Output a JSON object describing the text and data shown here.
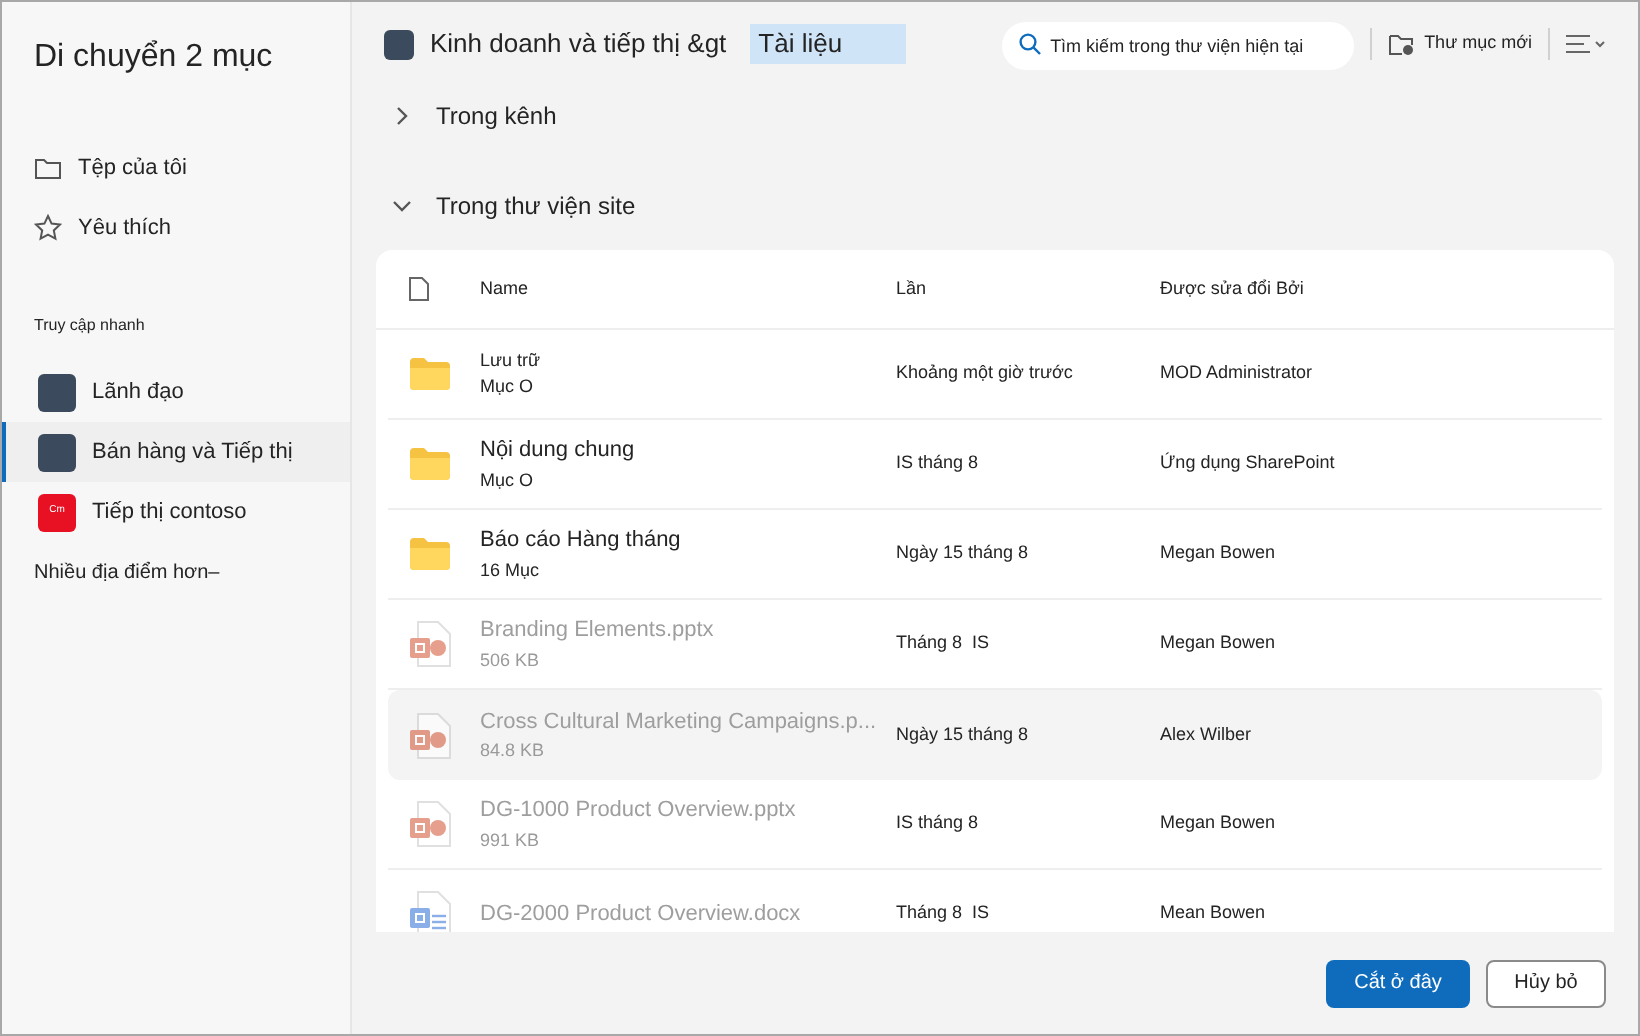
{
  "dialog": {
    "title": "Di chuyển 2 mục"
  },
  "sidebar": {
    "items": [
      {
        "kind": "folder",
        "label": "Tệp của tôi"
      },
      {
        "kind": "star",
        "label": "Yêu thích"
      }
    ],
    "quick_access": {
      "heading": "Truy cập nhanh",
      "items": [
        {
          "label": "Lãnh đạo",
          "color": "#3b4a5c",
          "selected": false
        },
        {
          "label": "Bán hàng và Tiếp thị",
          "color": "#3b4a5c",
          "selected": true
        },
        {
          "label": "Tiếp thị contoso",
          "color": "#e81123",
          "selected": false,
          "tile_text": "Cm"
        }
      ],
      "more": "Nhiều địa điểm hơn–"
    }
  },
  "breadcrumb": {
    "site": "Kinh doanh và tiếp thị &gt",
    "current": "Tài liệu"
  },
  "search": {
    "placeholder": "Tìm kiếm trong thư viện hiện tại"
  },
  "toolbar": {
    "new_folder": "Thư mục mới"
  },
  "sections": [
    {
      "label": "Trong kênh",
      "expanded": false
    },
    {
      "label": "Trong thư viện site",
      "expanded": true
    }
  ],
  "table": {
    "columns": [
      "Name",
      "Lần",
      "Được sửa đổi Bởi"
    ],
    "rows": [
      {
        "kind": "folder",
        "name": "Lưu trữ",
        "detail": "Mục O",
        "time": "Khoảng một giờ trước",
        "modified_by": "MOD Administrator",
        "disabled": false,
        "selected": false
      },
      {
        "kind": "folder",
        "name": "Nội dung chung",
        "detail": "Mục O",
        "time": "IS tháng 8",
        "modified_by": "Ứng dụng SharePoint",
        "disabled": false,
        "selected": false
      },
      {
        "kind": "folder",
        "name": "Báo cáo Hàng tháng",
        "detail": "16 Mục",
        "time": "Ngày 15 tháng 8",
        "modified_by": "Megan Bowen",
        "disabled": false,
        "selected": false
      },
      {
        "kind": "pptx",
        "name": "Branding Elements.pptx",
        "detail": "506 KB",
        "time": "Tháng 8  IS",
        "modified_by": "Megan Bowen",
        "disabled": true,
        "selected": false
      },
      {
        "kind": "pptx",
        "name": "Cross Cultural Marketing Campaigns.p...",
        "detail": "84.8 KB",
        "time": "Ngày 15 tháng 8",
        "modified_by": "Alex Wilber",
        "disabled": true,
        "selected": true
      },
      {
        "kind": "pptx",
        "name": "DG-1000 Product Overview.pptx",
        "detail": "991 KB",
        "time": "IS tháng 8",
        "modified_by": "Megan Bowen",
        "disabled": true,
        "selected": false
      },
      {
        "kind": "docx",
        "name": "DG-2000 Product Overview.docx",
        "time": "Tháng 8  IS",
        "modified_by": "Mean Bowen",
        "disabled": true,
        "selected": false
      }
    ]
  },
  "buttons": [
    {
      "kind": "primary",
      "label": "Cắt ở đây"
    },
    {
      "kind": "secondary",
      "label": "Hủy bỏ"
    }
  ]
}
